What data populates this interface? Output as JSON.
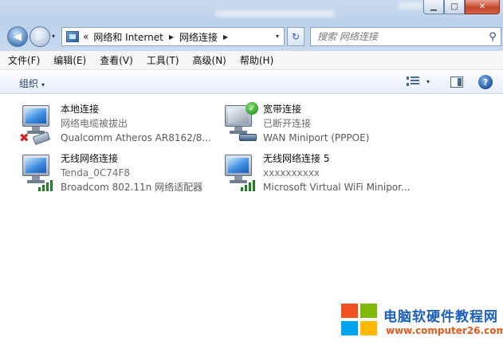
{
  "window": {
    "minimize_glyph": "▁",
    "maximize_glyph": "□",
    "close_glyph": "✕"
  },
  "navigation": {
    "back_glyph": "◀",
    "forward_glyph": "▶",
    "history_drop_glyph": "▾",
    "breadcrumb_overflow": "«",
    "breadcrumbs": [
      "网络和 Internet",
      "网络连接"
    ],
    "crumb_separator": "▶",
    "address_drop_glyph": "▾",
    "refresh_glyph": "↻"
  },
  "search": {
    "placeholder": "搜索 网络连接",
    "icon": "search-icon",
    "glyph": "⚲"
  },
  "menu": {
    "items": [
      "文件(F)",
      "编辑(E)",
      "查看(V)",
      "工具(T)",
      "高级(N)",
      "帮助(H)"
    ]
  },
  "command_bar": {
    "organize_label": "组织",
    "organize_drop_glyph": "▾",
    "view_drop_glyph": "▾",
    "help_glyph": "?"
  },
  "connections": [
    {
      "name": "本地连接",
      "status": "网络电缆被拔出",
      "device": "Qualcomm Atheros AR8162/8...",
      "icon": "ethernet-disconnected-icon",
      "badge_glyph": "✖"
    },
    {
      "name": "宽带连接",
      "status": "已断开连接",
      "device": "WAN Miniport (PPPOE)",
      "icon": "broadband-icon",
      "badge_glyph": "✓"
    },
    {
      "name": "无线网络连接",
      "status": "Tenda_0C74F8",
      "device": "Broadcom 802.11n 网络适配器",
      "icon": "wireless-icon"
    },
    {
      "name": "无线网络连接 5",
      "status": "xxxxxxxxxx",
      "device": "Microsoft Virtual WiFi Minipor...",
      "icon": "wireless-icon"
    }
  ],
  "watermark": {
    "title": "电脑软硬件教程网",
    "url": "www.computer26.com"
  },
  "colors": {
    "chrome": "#bcd1ea",
    "content_bg": "#ffffff",
    "watermark_title": "#1a5fc0",
    "watermark_url": "#e85a1a"
  }
}
